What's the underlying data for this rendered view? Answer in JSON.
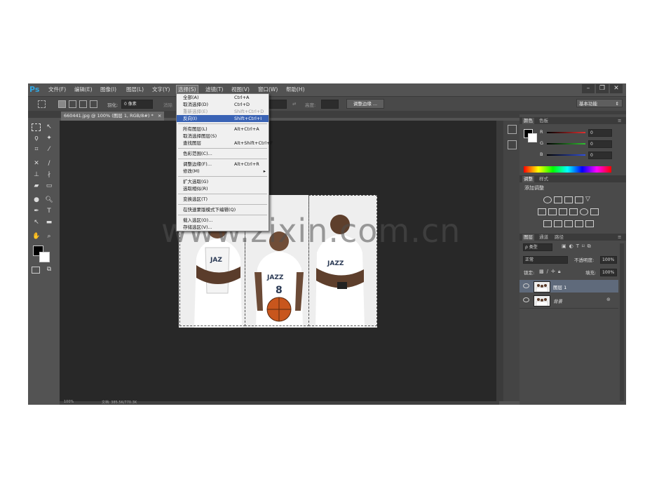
{
  "app": {
    "logo": "Ps",
    "menu": [
      "文件(F)",
      "编辑(E)",
      "图像(I)",
      "图层(L)",
      "文字(Y)",
      "选择(S)",
      "滤镜(T)",
      "视图(V)",
      "窗口(W)",
      "帮助(H)"
    ],
    "active_menu": "选择(S)",
    "window_buttons": [
      "–",
      "❐",
      "✕"
    ]
  },
  "options_bar": {
    "feather_label": "羽化:",
    "feather_value": "0 像素",
    "antialias_label": "消除",
    "height_label": "高度:",
    "refine_edge_button": "调整边缘 ...",
    "workspace": "基本功能"
  },
  "document_tab": {
    "title": "660441.jpg @ 100% (图层 1, RGB/8#) *",
    "close": "×"
  },
  "select_menu": {
    "items": [
      {
        "label": "全部(A)",
        "shortcut": "Ctrl+A",
        "disabled": false
      },
      {
        "label": "取消选择(D)",
        "shortcut": "Ctrl+D",
        "disabled": false
      },
      {
        "label": "重新选择(E)",
        "shortcut": "Shift+Ctrl+D",
        "disabled": true
      },
      {
        "label": "反向(I)",
        "shortcut": "Shift+Ctrl+I",
        "highlight": true
      },
      {
        "sep": true
      },
      {
        "label": "所有图层(L)",
        "shortcut": "Alt+Ctrl+A"
      },
      {
        "label": "取消选择图层(S)",
        "shortcut": ""
      },
      {
        "label": "查找图层",
        "shortcut": "Alt+Shift+Ctrl+F"
      },
      {
        "sep": true
      },
      {
        "label": "色彩范围(C)...",
        "shortcut": ""
      },
      {
        "sep": true
      },
      {
        "label": "调整边缘(F)...",
        "shortcut": "Alt+Ctrl+R"
      },
      {
        "label": "修改(M)",
        "shortcut": "",
        "submenu": true
      },
      {
        "sep": true
      },
      {
        "label": "扩大选取(G)",
        "shortcut": ""
      },
      {
        "label": "选取相似(R)",
        "shortcut": ""
      },
      {
        "sep": true
      },
      {
        "label": "变换选区(T)",
        "shortcut": ""
      },
      {
        "sep": true
      },
      {
        "label": "在快速蒙版模式下编辑(Q)",
        "shortcut": ""
      },
      {
        "sep": true
      },
      {
        "label": "载入选区(O)...",
        "shortcut": ""
      },
      {
        "label": "存储选区(V)...",
        "shortcut": ""
      }
    ]
  },
  "watermark": "www.zixin.com.cn",
  "status_bar": {
    "zoom": "100%",
    "info": "文档: 385.5K/770.3K"
  },
  "color_panel": {
    "tabs": [
      "颜色",
      "色板"
    ],
    "channels": [
      {
        "label": "R",
        "value": "0",
        "color": "#e03030"
      },
      {
        "label": "G",
        "value": "0",
        "color": "#30c030"
      },
      {
        "label": "B",
        "value": "0",
        "color": "#3050e0"
      }
    ]
  },
  "adjustments_panel": {
    "tabs": [
      "调整",
      "样式"
    ],
    "heading": "添加调整"
  },
  "layers_panel": {
    "tabs": [
      "图层",
      "通道",
      "路径"
    ],
    "filter_label": "ρ 类型",
    "blend_mode": "正常",
    "opacity_label": "不透明度:",
    "opacity_value": "100%",
    "lock_label": "锁定:",
    "fill_label": "填充:",
    "fill_value": "100%",
    "layers": [
      {
        "name": "图层 1",
        "selected": true
      },
      {
        "name": "背景",
        "selected": false,
        "locked": true
      }
    ]
  }
}
